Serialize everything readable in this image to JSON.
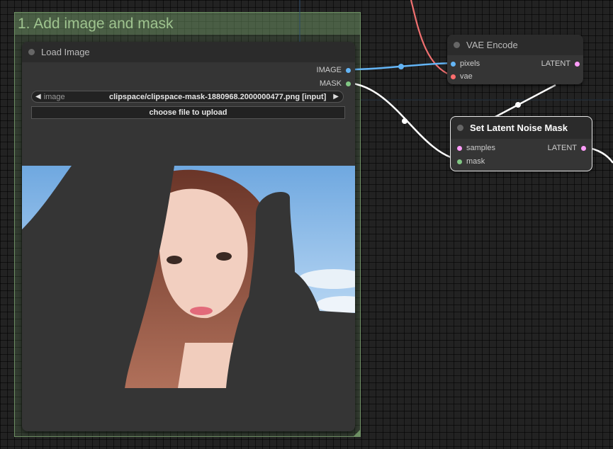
{
  "group": {
    "title": "1. Add image and mask"
  },
  "load_image": {
    "title": "Load Image",
    "outputs": {
      "image": "IMAGE",
      "mask": "MASK"
    },
    "image_widget": {
      "label": "image",
      "value": "clipspace/clipspace-mask-1880968.2000000477.png [input]"
    },
    "upload_label": "choose file to upload"
  },
  "vae_encode": {
    "title": "VAE Encode",
    "inputs": {
      "pixels": "pixels",
      "vae": "vae"
    },
    "output": "LATENT"
  },
  "set_latent": {
    "title": "Set Latent Noise Mask",
    "inputs": {
      "samples": "samples",
      "mask": "mask"
    },
    "output": "LATENT"
  },
  "colors": {
    "image_port": "#64b5f6",
    "mask_port": "#81c784",
    "latent_port": "#ff9cf9",
    "vae_port": "#ff6e6e",
    "group_bg": "#6d8f63"
  }
}
